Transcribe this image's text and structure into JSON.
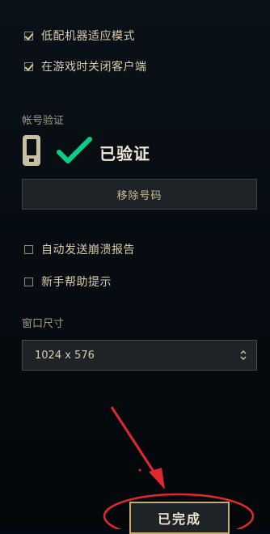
{
  "checkboxes_top": [
    {
      "label": "低配机器适应模式",
      "checked": true
    },
    {
      "label": "在游戏时关闭客户端",
      "checked": true
    }
  ],
  "account": {
    "section_label": "帐号验证",
    "status": "已验证",
    "remove_button": "移除号码"
  },
  "checkboxes_bottom": [
    {
      "label": "自动发送崩溃报告",
      "checked": false
    },
    {
      "label": "新手帮助提示",
      "checked": false
    }
  ],
  "window_size": {
    "section_label": "窗口尺寸",
    "selected": "1024 x 576"
  },
  "done_button": "已完成",
  "colors": {
    "accent_gold": "#c8aa6e",
    "check_green": "#0acf83",
    "annotation_red": "#e0282e"
  },
  "icons": {
    "phone": "phone-icon",
    "check": "green-checkmark-icon",
    "select_arrows": "updown-arrows-icon"
  }
}
